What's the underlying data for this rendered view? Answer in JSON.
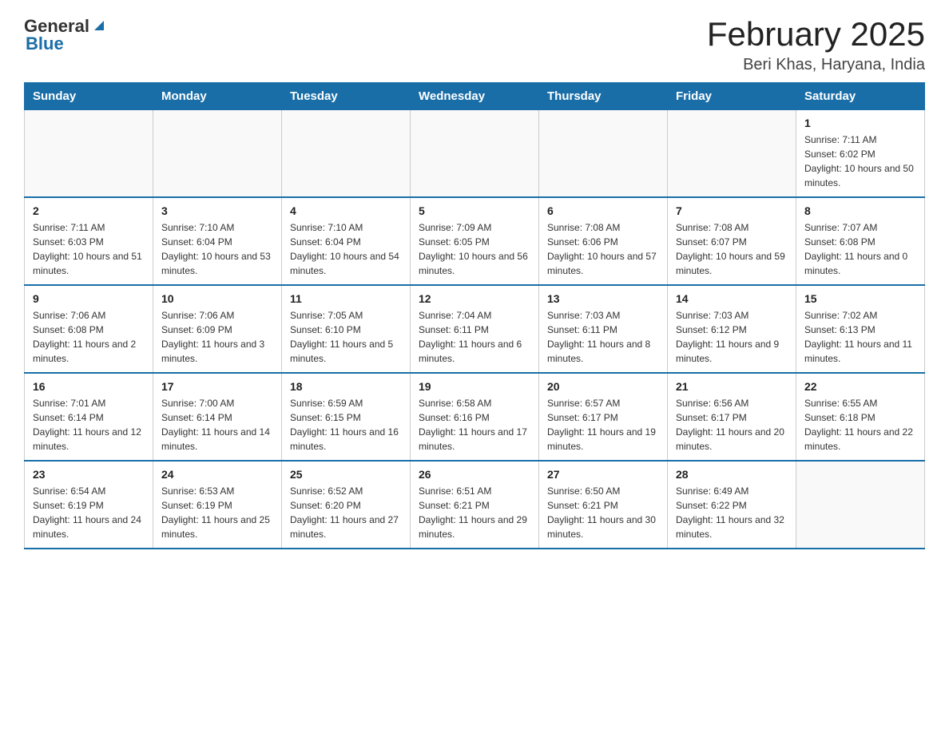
{
  "logo": {
    "general": "General",
    "blue": "Blue"
  },
  "title": "February 2025",
  "subtitle": "Beri Khas, Haryana, India",
  "weekdays": [
    "Sunday",
    "Monday",
    "Tuesday",
    "Wednesday",
    "Thursday",
    "Friday",
    "Saturday"
  ],
  "weeks": [
    [
      {
        "day": "",
        "info": ""
      },
      {
        "day": "",
        "info": ""
      },
      {
        "day": "",
        "info": ""
      },
      {
        "day": "",
        "info": ""
      },
      {
        "day": "",
        "info": ""
      },
      {
        "day": "",
        "info": ""
      },
      {
        "day": "1",
        "info": "Sunrise: 7:11 AM\nSunset: 6:02 PM\nDaylight: 10 hours and 50 minutes."
      }
    ],
    [
      {
        "day": "2",
        "info": "Sunrise: 7:11 AM\nSunset: 6:03 PM\nDaylight: 10 hours and 51 minutes."
      },
      {
        "day": "3",
        "info": "Sunrise: 7:10 AM\nSunset: 6:04 PM\nDaylight: 10 hours and 53 minutes."
      },
      {
        "day": "4",
        "info": "Sunrise: 7:10 AM\nSunset: 6:04 PM\nDaylight: 10 hours and 54 minutes."
      },
      {
        "day": "5",
        "info": "Sunrise: 7:09 AM\nSunset: 6:05 PM\nDaylight: 10 hours and 56 minutes."
      },
      {
        "day": "6",
        "info": "Sunrise: 7:08 AM\nSunset: 6:06 PM\nDaylight: 10 hours and 57 minutes."
      },
      {
        "day": "7",
        "info": "Sunrise: 7:08 AM\nSunset: 6:07 PM\nDaylight: 10 hours and 59 minutes."
      },
      {
        "day": "8",
        "info": "Sunrise: 7:07 AM\nSunset: 6:08 PM\nDaylight: 11 hours and 0 minutes."
      }
    ],
    [
      {
        "day": "9",
        "info": "Sunrise: 7:06 AM\nSunset: 6:08 PM\nDaylight: 11 hours and 2 minutes."
      },
      {
        "day": "10",
        "info": "Sunrise: 7:06 AM\nSunset: 6:09 PM\nDaylight: 11 hours and 3 minutes."
      },
      {
        "day": "11",
        "info": "Sunrise: 7:05 AM\nSunset: 6:10 PM\nDaylight: 11 hours and 5 minutes."
      },
      {
        "day": "12",
        "info": "Sunrise: 7:04 AM\nSunset: 6:11 PM\nDaylight: 11 hours and 6 minutes."
      },
      {
        "day": "13",
        "info": "Sunrise: 7:03 AM\nSunset: 6:11 PM\nDaylight: 11 hours and 8 minutes."
      },
      {
        "day": "14",
        "info": "Sunrise: 7:03 AM\nSunset: 6:12 PM\nDaylight: 11 hours and 9 minutes."
      },
      {
        "day": "15",
        "info": "Sunrise: 7:02 AM\nSunset: 6:13 PM\nDaylight: 11 hours and 11 minutes."
      }
    ],
    [
      {
        "day": "16",
        "info": "Sunrise: 7:01 AM\nSunset: 6:14 PM\nDaylight: 11 hours and 12 minutes."
      },
      {
        "day": "17",
        "info": "Sunrise: 7:00 AM\nSunset: 6:14 PM\nDaylight: 11 hours and 14 minutes."
      },
      {
        "day": "18",
        "info": "Sunrise: 6:59 AM\nSunset: 6:15 PM\nDaylight: 11 hours and 16 minutes."
      },
      {
        "day": "19",
        "info": "Sunrise: 6:58 AM\nSunset: 6:16 PM\nDaylight: 11 hours and 17 minutes."
      },
      {
        "day": "20",
        "info": "Sunrise: 6:57 AM\nSunset: 6:17 PM\nDaylight: 11 hours and 19 minutes."
      },
      {
        "day": "21",
        "info": "Sunrise: 6:56 AM\nSunset: 6:17 PM\nDaylight: 11 hours and 20 minutes."
      },
      {
        "day": "22",
        "info": "Sunrise: 6:55 AM\nSunset: 6:18 PM\nDaylight: 11 hours and 22 minutes."
      }
    ],
    [
      {
        "day": "23",
        "info": "Sunrise: 6:54 AM\nSunset: 6:19 PM\nDaylight: 11 hours and 24 minutes."
      },
      {
        "day": "24",
        "info": "Sunrise: 6:53 AM\nSunset: 6:19 PM\nDaylight: 11 hours and 25 minutes."
      },
      {
        "day": "25",
        "info": "Sunrise: 6:52 AM\nSunset: 6:20 PM\nDaylight: 11 hours and 27 minutes."
      },
      {
        "day": "26",
        "info": "Sunrise: 6:51 AM\nSunset: 6:21 PM\nDaylight: 11 hours and 29 minutes."
      },
      {
        "day": "27",
        "info": "Sunrise: 6:50 AM\nSunset: 6:21 PM\nDaylight: 11 hours and 30 minutes."
      },
      {
        "day": "28",
        "info": "Sunrise: 6:49 AM\nSunset: 6:22 PM\nDaylight: 11 hours and 32 minutes."
      },
      {
        "day": "",
        "info": ""
      }
    ]
  ]
}
